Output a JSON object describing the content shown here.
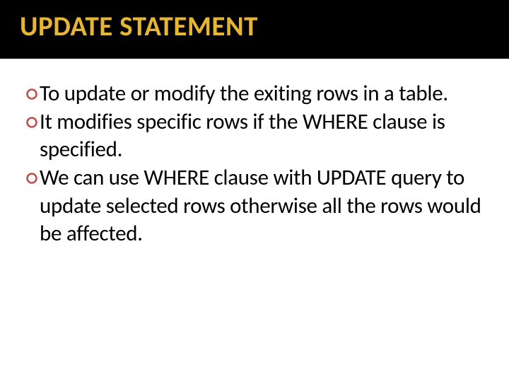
{
  "title": "UPDATE STATEMENT",
  "bullets": [
    {
      "text": "To update or modify the exiting rows in a table."
    },
    {
      "text": "It modifies specific rows if the WHERE clause is specified."
    },
    {
      "text": "We can use WHERE clause with UPDATE query to update selected rows otherwise all the rows would be affected."
    }
  ],
  "colors": {
    "title_bg": "#000000",
    "title_fg": "#e6b633",
    "body_fg": "#000000",
    "bullet_stroke": "#c0504d"
  }
}
